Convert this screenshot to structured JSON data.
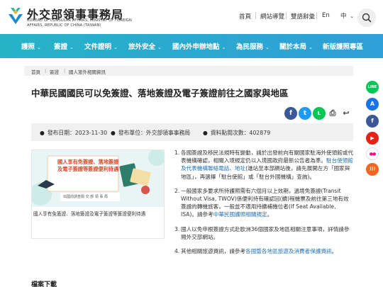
{
  "header": {
    "title": "外交部領事事務局",
    "subtitle_en_1": "BUREAU OF CONSULAR AFFAIRS, MINISTRY OF FOREIGN",
    "subtitle_en_2": "AFFAIRS, REPUBLIC OF CHINA (TAIWAN)",
    "links": [
      "首頁",
      "網站導覽",
      "雙語辭彙",
      "En"
    ],
    "language": "中",
    "language_caret": "⌄"
  },
  "nav": {
    "items": [
      "護照",
      "簽證",
      "文件證明",
      "旅外安全",
      "國內外申辦地點",
      "為民服務",
      "關於本局",
      "新版護照專區"
    ],
    "caret": "⌄"
  },
  "breadcrumb": [
    "首頁",
    "簽證",
    "國人旅外相關資訊"
  ],
  "breadcrumb_sep": "|",
  "page_title": "中華民國國民可以免簽證、落地簽證及電子簽證前往之國家與地區",
  "info": {
    "date": "發布日期：2023-11-30",
    "unit": "發布單位：外交部領事事務局",
    "views": "資料點閱次數：402879",
    "bullet": "●"
  },
  "card": {
    "banner_line1": "國人享有免簽證、落地簽證",
    "banner_line2": "及電子簽證等簽證便利待遇",
    "banner_small": "出國前請查閱 交 部 領 事 局",
    "caption": "國人享有免簽證、落地簽證及電子簽證等簽證便利待遇"
  },
  "content": {
    "items": [
      {
        "num": "1.",
        "text": "各國簽證及移民法規時有變動，請於出發前向有關國家駐海外使領館或代表機構確認，相關入境規定仍以入境國政府最新公告者為準。",
        "link": "駐台使領館及代表機構聯絡電話、地址",
        "tail": "(進站至本部網站後，請先展開左方「國家與地區」，再選擇「駐台使館」或「駐台外國機構」查詢)。"
      },
      {
        "num": "2.",
        "text": "一般國家多要求所持護照需有六個月以上效期，過境免簽證(Transit Without Visa, TWOV)係便利持有確認回(續)程機票及前往第三地有效簽證的轉機旅客，一般並不適用持續補機位者(If Seat Available, ISA)。請參考",
        "link": "中華民國護照相關規定",
        "tail": "。"
      },
      {
        "num": "3.",
        "text": "國人以免申根簽證方式赴歐洲36個國家及地區相關注意事項，詳情請參閱外交部網站。",
        "link": "",
        "tail": ""
      },
      {
        "num": "4.",
        "text": "其他相關旅遊資訊，請參考",
        "link": "各國暨各地區旅遊及消費者保護資訊",
        "tail": "。"
      }
    ]
  },
  "downloads_heading": "檔案下載",
  "share": {
    "facebook": "f",
    "twitter": "t",
    "line": "L",
    "print": "⎙",
    "back": "↩"
  },
  "rail": {
    "line": "LINE",
    "app": "A",
    "facebook": "f",
    "youtube": "▶",
    "flickr": "●●",
    "rss": ")))"
  },
  "colors": {
    "nav_start": "#26b3c6",
    "nav_end": "#2e9fd8",
    "link": "#1f6fb5"
  }
}
